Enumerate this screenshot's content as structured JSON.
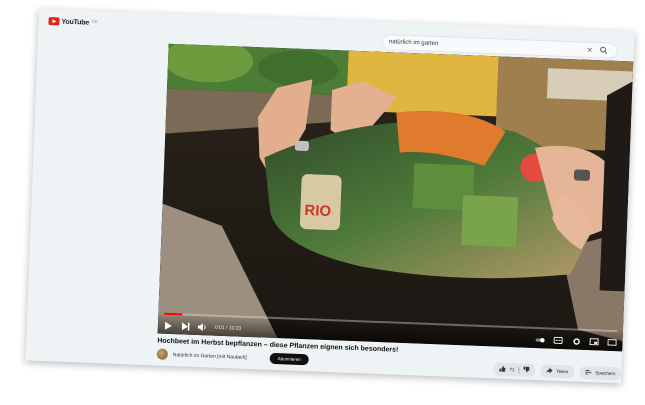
{
  "header": {
    "logo_text": "YouTube",
    "country_code": "DE",
    "search_value": "natürlich im garten"
  },
  "player": {
    "time_display": "0:01 / 10:23",
    "progress_fraction": 0.04,
    "bag_brand": "RIO"
  },
  "video": {
    "title": "Hochbeet im Herbst bepflanzen – diese Pflanzen eignen sich besonders!",
    "channel": "Natürlich im Garten [mit Nauberli]",
    "subscribe_label": "Abonnieren"
  },
  "actions": {
    "like_count": "71",
    "share_label": "Teilen",
    "save_label": "Speichern"
  },
  "colors": {
    "brand_red": "#e62117",
    "progress_red": "#ff0000"
  },
  "icons": [
    "youtube-logo-icon",
    "close-icon",
    "search-icon",
    "play-icon",
    "next-icon",
    "volume-icon",
    "autoplay-toggle-icon",
    "subtitles-icon",
    "settings-icon",
    "miniplayer-icon",
    "theater-icon",
    "thumbs-up-icon",
    "thumbs-down-icon",
    "share-icon",
    "save-icon"
  ]
}
